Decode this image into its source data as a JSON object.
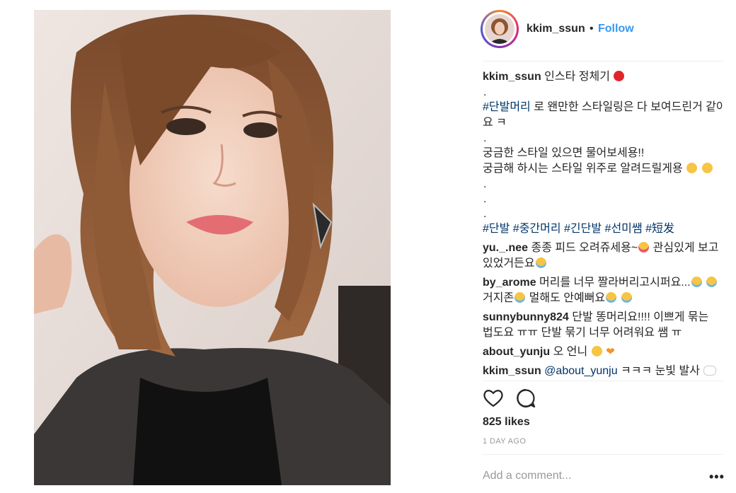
{
  "post": {
    "author": "kkim_ssun",
    "separator": "•",
    "follow_label": "Follow",
    "caption": {
      "username": "kkim_ssun",
      "line1": "인스타 정체기",
      "dot": ".",
      "hashtag1": "#단발머리",
      "line2_rest": "로 왠만한 스타일링은 다 보여드린거 같아",
      "line3": "요 ㅋ",
      "line4": "궁금한 스타일 있으면 물어보세용!!",
      "line5": "궁금해 하시는 스타일 위주로 알려드릴게용",
      "hashtags": [
        "#단발",
        "#중간머리",
        "#긴단발",
        "#선미쌤",
        "#短发"
      ]
    },
    "comments": [
      {
        "username": "yu._.nee",
        "line1": "종종 피드 오려쥬세용~",
        "line1b": "관심있게 보고",
        "line2": "있었거든요"
      },
      {
        "username": "by_arome",
        "line1": "머리를 너무 짤라버리고시퍼요...",
        "line2a": "거지존",
        "line2b": "멀해도 안예뻐요"
      },
      {
        "username": "sunnybunny824",
        "line1": "단발 똥머리요!!!! 이쁘게 묶는",
        "line2": "법도요 ㅠㅠ 단발 묶기 너무 어려워요 쌤 ㅠ"
      },
      {
        "username": "about_yunju",
        "line1": "오 언니"
      },
      {
        "username": "kkim_ssun",
        "mention": "@about_yunju",
        "line1": "ㅋㅋㅋ 눈빛 발사"
      }
    ],
    "likes": "825 likes",
    "time": "1 DAY AGO",
    "add_comment_placeholder": "Add a comment...",
    "more": "•••"
  },
  "icons": [
    "heart-icon",
    "comment-icon",
    "more-options-icon"
  ],
  "colors": {
    "link": "#3897f0",
    "hashtag": "#003569",
    "muted": "#999999",
    "text": "#262626"
  }
}
